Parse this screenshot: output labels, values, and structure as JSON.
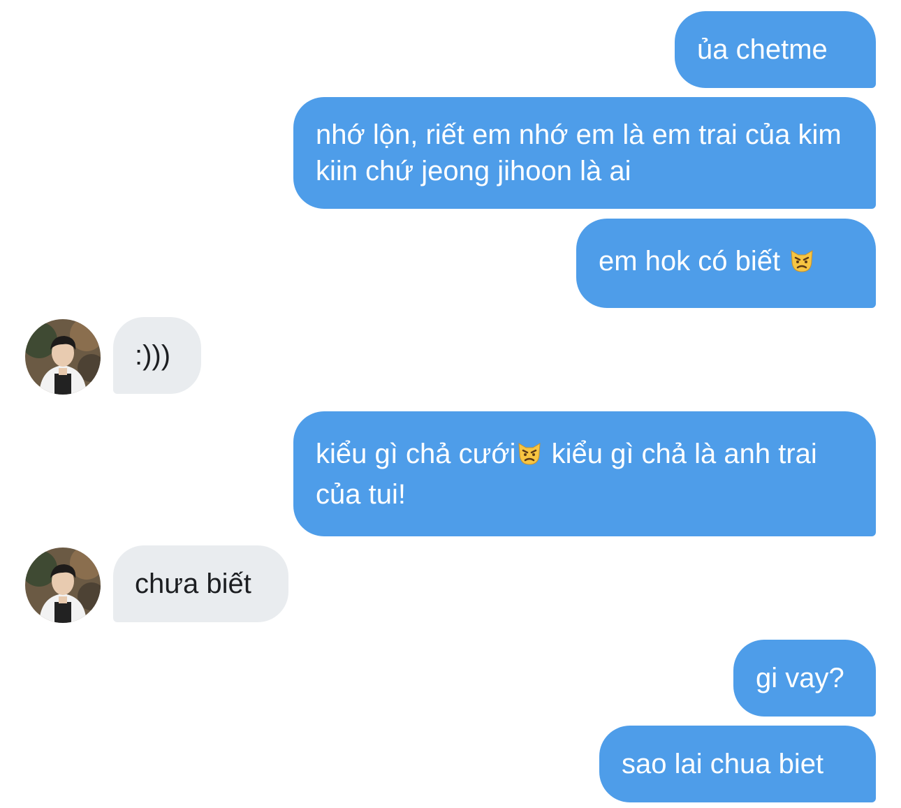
{
  "conversation": {
    "messages": [
      {
        "from": "me",
        "text": "ủa chetme"
      },
      {
        "from": "me",
        "text": "nhớ lộn, riết em nhớ em là em trai của kim kiin chứ jeong jihoon là ai"
      },
      {
        "from": "me",
        "text": "em hok có biết",
        "emoji": "pouting-cat"
      },
      {
        "from": "other",
        "text": ":)))"
      },
      {
        "from": "me",
        "text_before": "kiểu gì chả cưới",
        "emoji": "pouting-cat",
        "text_after": " kiểu gì chả là anh trai của tui!"
      },
      {
        "from": "other",
        "text": "chưa biết"
      },
      {
        "from": "me",
        "text": "gi vay?"
      },
      {
        "from": "me",
        "text": "sao lai chua biet"
      }
    ]
  },
  "colors": {
    "sent_bubble": "#4e9de9",
    "received_bubble": "#e9ecef",
    "sent_text": "#ffffff",
    "received_text": "#1c1e21"
  },
  "icons": {
    "avatar": "user-avatar-photo",
    "emoji": "pouting-cat-emoji"
  }
}
